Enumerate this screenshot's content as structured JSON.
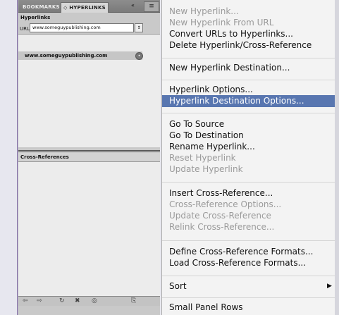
{
  "panel": {
    "tabs": [
      "BOOKMARKS",
      "◇ HYPERLINKS"
    ],
    "collapse_icon": "«",
    "menu_icon": "≡",
    "hyperlinks_title": "Hyperlinks",
    "url_label": "URL:",
    "url_value": "www.someguypublishing.com",
    "url_stepper": "↕",
    "hyperlink_item": "www.someguypublishing.com",
    "hyperlink_item_icon": "•",
    "cross_refs_title": "Cross-References",
    "toolbar_icons": [
      "⇦",
      "⇨",
      "↻",
      "✖",
      "◎",
      "⎘"
    ]
  },
  "menu": {
    "items": [
      {
        "label": "New Hyperlink...",
        "enabled": false
      },
      {
        "label": "New Hyperlink From URL",
        "enabled": false
      },
      {
        "label": "Convert URLs to Hyperlinks...",
        "enabled": true
      },
      {
        "label": "Delete Hyperlink/Cross-Reference",
        "enabled": true
      },
      {
        "label": "New Hyperlink Destination...",
        "enabled": true
      },
      {
        "label": "Hyperlink Options...",
        "enabled": true
      },
      {
        "label": "Hyperlink Destination Options...",
        "enabled": true,
        "highlighted": true
      },
      {
        "label": "Go To Source",
        "enabled": true
      },
      {
        "label": "Go To Destination",
        "enabled": true
      },
      {
        "label": "Rename Hyperlink...",
        "enabled": true
      },
      {
        "label": "Reset Hyperlink",
        "enabled": false
      },
      {
        "label": "Update Hyperlink",
        "enabled": false
      },
      {
        "label": "Insert Cross-Reference...",
        "enabled": true
      },
      {
        "label": "Cross-Reference Options...",
        "enabled": false
      },
      {
        "label": "Update Cross-Reference",
        "enabled": false
      },
      {
        "label": "Relink Cross-Reference...",
        "enabled": false
      },
      {
        "label": "Define Cross-Reference Formats...",
        "enabled": true
      },
      {
        "label": "Load Cross-Reference Formats...",
        "enabled": true
      },
      {
        "label": "Sort",
        "enabled": true,
        "submenu": true
      },
      {
        "label": "Small Panel Rows",
        "enabled": true
      }
    ],
    "submenu_arrow": "▶"
  }
}
